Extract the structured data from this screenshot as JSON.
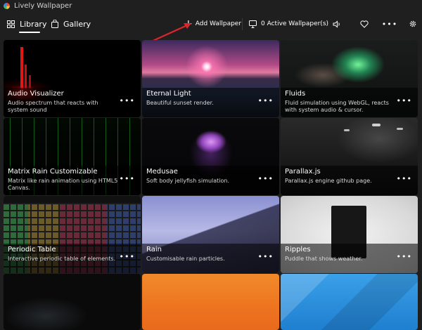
{
  "app": {
    "title": "Lively Wallpaper"
  },
  "nav": {
    "library_label": "Library",
    "gallery_label": "Gallery",
    "add_wallpaper_label": "Add Wallpaper",
    "active_wallpapers_label": "0 Active Wallpaper(s)"
  },
  "tiles": [
    {
      "title": "Audio Visualizer",
      "desc": "Audio spectrum that reacts with system sound"
    },
    {
      "title": "Eternal Light",
      "desc": "Beautiful sunset render."
    },
    {
      "title": "Fluids",
      "desc": "Fluid simulation using WebGL, reacts with system audio & cursor."
    },
    {
      "title": "Matrix Rain Customizable",
      "desc": "Matrix like rain animation using HTML5 Canvas."
    },
    {
      "title": "Medusae",
      "desc": "Soft body jellyfish simulation."
    },
    {
      "title": "Parallax.js",
      "desc": "Parallax.js engine github page."
    },
    {
      "title": "Periodic Table",
      "desc": "Interactive periodic table of elements."
    },
    {
      "title": "Rain",
      "desc": "Customisable rain particles."
    },
    {
      "title": "Ripples",
      "desc": "Puddle that shows weather."
    }
  ],
  "more_glyph": "•••",
  "colors": {
    "accent_arrow": "#d9262c",
    "background": "#1f1f1f"
  }
}
